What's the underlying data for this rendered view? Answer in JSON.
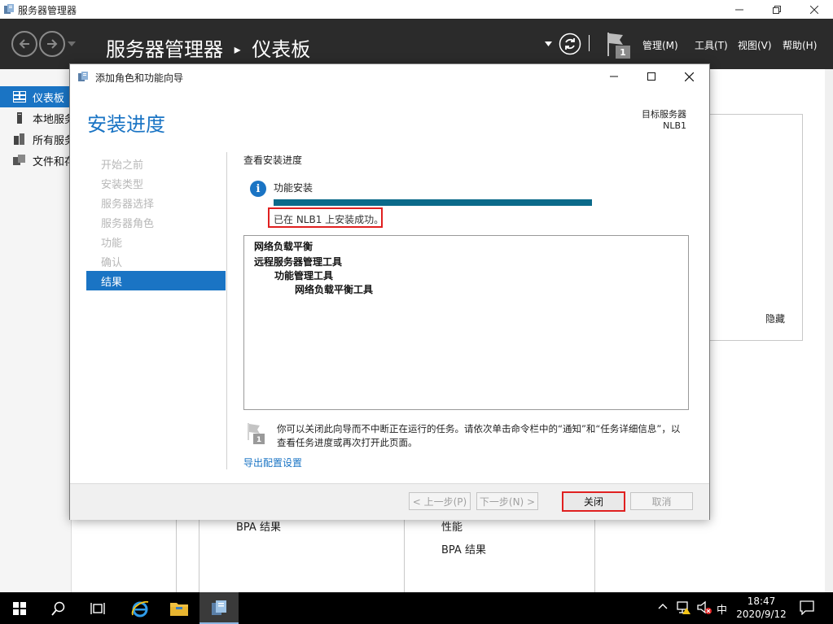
{
  "window": {
    "title": "服务器管理器"
  },
  "header": {
    "breadcrumb_root": "服务器管理器",
    "breadcrumb_sep": "▸",
    "breadcrumb_page": "仪表板",
    "notification_count": "1",
    "menus": [
      "管理(M)",
      "工具(T)",
      "视图(V)",
      "帮助(H)"
    ]
  },
  "sidebar": {
    "items": [
      {
        "label": "仪表板"
      },
      {
        "label": "本地服务器"
      },
      {
        "label": "所有服务器"
      },
      {
        "label": "文件和存储服务"
      }
    ]
  },
  "background": {
    "hide_label": "隐藏",
    "bpa_left": "BPA 结果",
    "perf_right": "性能",
    "bpa_right": "BPA 结果"
  },
  "dialog": {
    "title": "添加角色和功能向导",
    "heading": "安装进度",
    "target_label": "目标服务器",
    "target_value": "NLB1",
    "steps": [
      "开始之前",
      "安装类型",
      "服务器选择",
      "服务器角色",
      "功能",
      "确认"
    ],
    "current_step": "结果",
    "view_progress": "查看安装进度",
    "feature_install": "功能安装",
    "progress_percent": 100,
    "success_text": "已在 NLB1 上安装成功。",
    "results": {
      "line1": "网络负载平衡",
      "line2": "远程服务器管理工具",
      "line3": "功能管理工具",
      "line4": "网络负载平衡工具"
    },
    "note_line1": "你可以关闭此向导而不中断正在运行的任务。请依次单击命令栏中的“通知”和“任务详细信息”，以",
    "note_line2": "查看任务进度或再次打开此页面。",
    "note_badge": "1",
    "export_link": "导出配置设置",
    "buttons": {
      "prev": "< 上一步(P)",
      "next": "下一步(N) >",
      "close": "关闭",
      "cancel": "取消"
    }
  },
  "taskbar": {
    "ime": "中",
    "time": "18:47",
    "date": "2020/9/12"
  }
}
